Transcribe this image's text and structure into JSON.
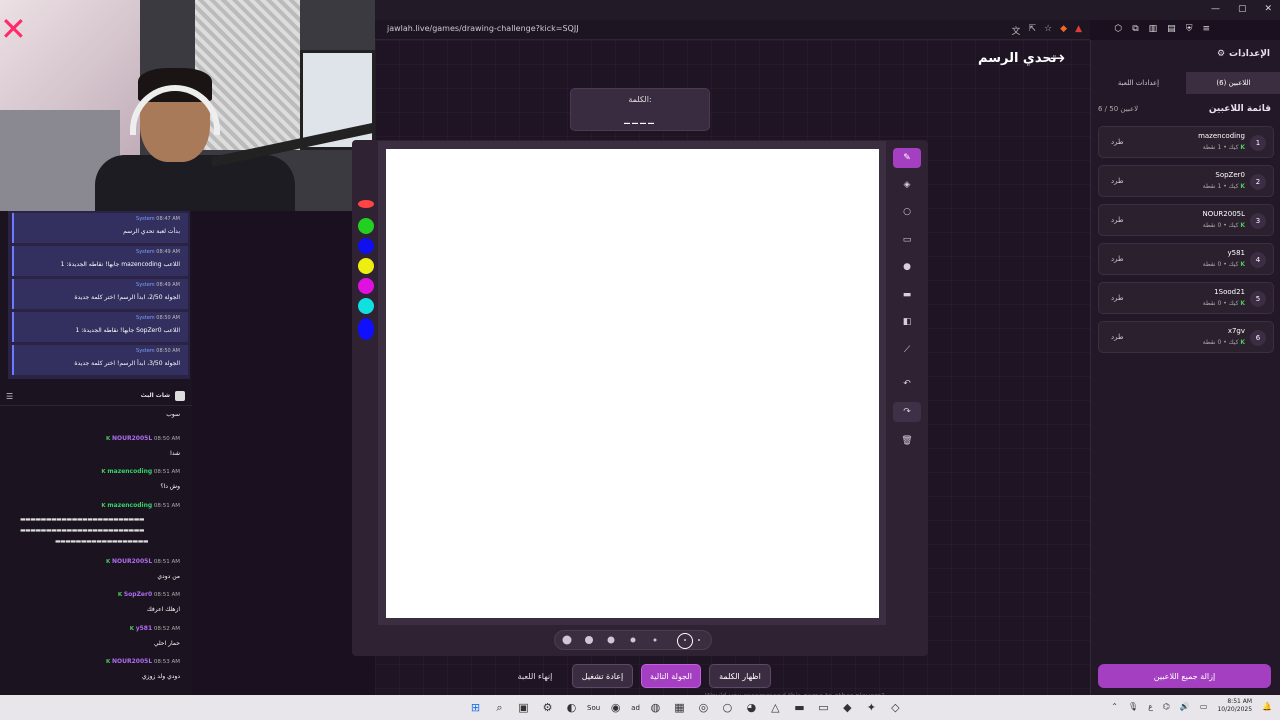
{
  "browser": {
    "url": "jawlah.live/games/drawing-challenge?kick=SQJJ",
    "tab_badge": "4"
  },
  "page": {
    "title": "تحدي الرسم",
    "word_label": "الكلمة:",
    "word_blanks": "____"
  },
  "toolbar": {
    "tools": [
      "pencil-icon",
      "eraser-icon",
      "circle-outline-icon",
      "rectangle-outline-icon",
      "circle-fill-icon",
      "rectangle-fill-icon",
      "fill-bucket-icon",
      "line-icon",
      "undo-icon",
      "redo-icon",
      "trash-icon"
    ]
  },
  "colors": {
    "swatches": [
      "#ff4444",
      "#22d022",
      "#1010ee",
      "#eeee10",
      "#e010e0",
      "#10e0e0",
      "#1010ff"
    ]
  },
  "controls": {
    "end_game": "إنهاء اللعبة",
    "restart": "إعادة تشغيل",
    "next_round": "الجولة التالية",
    "reveal_word": "اظهار الكلمة"
  },
  "settings": {
    "title": "الإعدادات",
    "tab_players": "اللاعبين (6)",
    "tab_game_settings": "إعدادات اللعبة",
    "players_title": "قائمة اللاعبين",
    "players_count": "6 / 50 لاعبين",
    "kick_label": "طرد",
    "remove_all": "إزالة جميع اللاعبين",
    "players": [
      {
        "num": "1",
        "name": "mazencoding",
        "meta": "كيك • 1 نقطة"
      },
      {
        "num": "2",
        "name": "SopZer0",
        "meta": "كيك • 1 نقطة"
      },
      {
        "num": "3",
        "name": "NOUR2005L",
        "meta": "كيك • 0 نقطة"
      },
      {
        "num": "4",
        "name": "y581",
        "meta": "كيك • 0 نقطة"
      },
      {
        "num": "5",
        "name": "1Sood21",
        "meta": "كيك • 0 نقطة"
      },
      {
        "num": "6",
        "name": "x7gv",
        "meta": "كيك • 0 نقطة"
      }
    ]
  },
  "system_messages": [
    {
      "time": "08:47 AM",
      "sender": "System",
      "text": "بدأت لعبة تحدي الرسم"
    },
    {
      "time": "08:49 AM",
      "sender": "System",
      "text": "اللاعب mazencoding جابها! نقاطه الجديدة: 1"
    },
    {
      "time": "08:49 AM",
      "sender": "System",
      "text": "الجولة 2/50، ابدأ الرسم! اختر كلمة جديدة"
    },
    {
      "time": "08:50 AM",
      "sender": "System",
      "text": "اللاعب SopZer0 جابها! نقاطه الجديدة: 1"
    },
    {
      "time": "08:50 AM",
      "sender": "System",
      "text": "الجولة 3/50، ابدأ الرسم! اختر كلمة جديدة"
    }
  ],
  "chat": {
    "title": "شات البث",
    "partial": "سوب",
    "messages": [
      {
        "time": "08:50 AM",
        "name": "NOUR2005L",
        "name_color": "#b06cf0",
        "text": "شدا"
      },
      {
        "time": "08:51 AM",
        "name": "mazencoding",
        "name_color": "#32d46a",
        "text": "وش دا؟"
      },
      {
        "time": "08:51 AM",
        "name": "mazencoding",
        "name_color": "#32d46a",
        "text": ""
      },
      {
        "time": "08:51 AM",
        "name": "NOUR2005L",
        "name_color": "#b06cf0",
        "text": "من دودي"
      },
      {
        "time": "08:51 AM",
        "name": "SopZer0",
        "name_color": "#b06cf0",
        "text": "ازهلك اعرفك"
      },
      {
        "time": "08:52 AM",
        "name": "y581",
        "name_color": "#b06cf0",
        "text": "حمار احلي"
      },
      {
        "time": "08:53 AM",
        "name": "NOUR2005L",
        "name_color": "#b06cf0",
        "text": "دودي ولد زوزي"
      }
    ],
    "long_text_1": "▬▬▬▬▬▬▬▬▬▬▬▬▬▬▬▬▬▬▬▬▬▬▬▬",
    "long_text_2": "▬▬▬▬▬▬▬▬▬▬▬▬▬▬▬▬▬▬▬▬▬▬▬▬",
    "long_text_3": "▬▬▬▬▬▬▬▬▬▬▬▬▬▬▬▬▬▬"
  },
  "taskbar": {
    "app_label": "Sou",
    "app_label2": "ad",
    "lang": "ع",
    "time": "8:51 AM",
    "date": "10/20/2025",
    "toast": "Would you recommend this game to other players?"
  }
}
